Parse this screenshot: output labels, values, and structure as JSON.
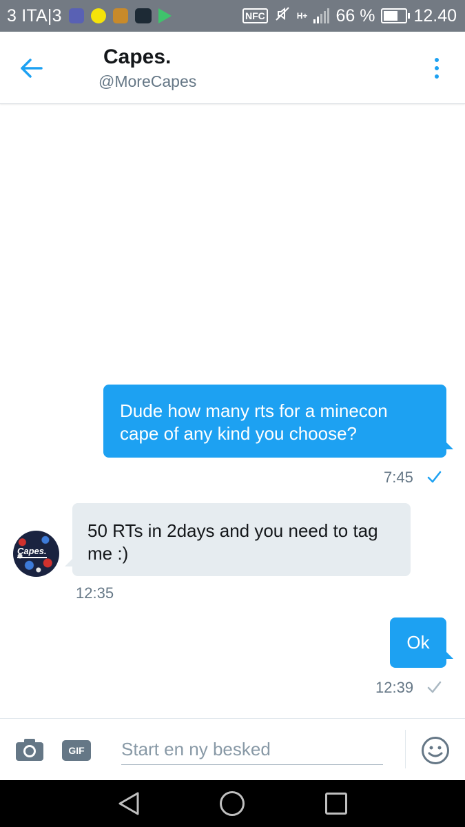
{
  "status_bar": {
    "carrier": "3 ITA|3",
    "nfc": "NFC",
    "network_type": "H+",
    "battery_percent": "66 %",
    "battery_level": 0.66,
    "time": "12.40"
  },
  "header": {
    "name": "Capes.",
    "handle": "@MoreCapes"
  },
  "messages": [
    {
      "direction": "sent",
      "text": "Dude how many rts for a minecon cape of any kind you choose?",
      "time": "7:45",
      "status": "read"
    },
    {
      "direction": "received",
      "text": "50 RTs in 2days and you need to tag me :)",
      "time": "12:35",
      "avatar_text": "Capes."
    },
    {
      "direction": "sent",
      "text": "Ok",
      "time": "12:39",
      "status": "sent"
    }
  ],
  "composer": {
    "gif_label": "GIF",
    "placeholder": "Start en ny besked"
  },
  "colors": {
    "accent": "#1da1f2",
    "received_bubble": "#e6ecf0",
    "status_bar": "#737a83",
    "read_check": "#1da1f2",
    "sent_check": "#aab8c2"
  },
  "icons": {
    "back": "arrow-left-icon",
    "more": "more-vertical-icon",
    "camera": "camera-icon",
    "gif": "gif-icon",
    "emoji": "emoji-icon"
  }
}
